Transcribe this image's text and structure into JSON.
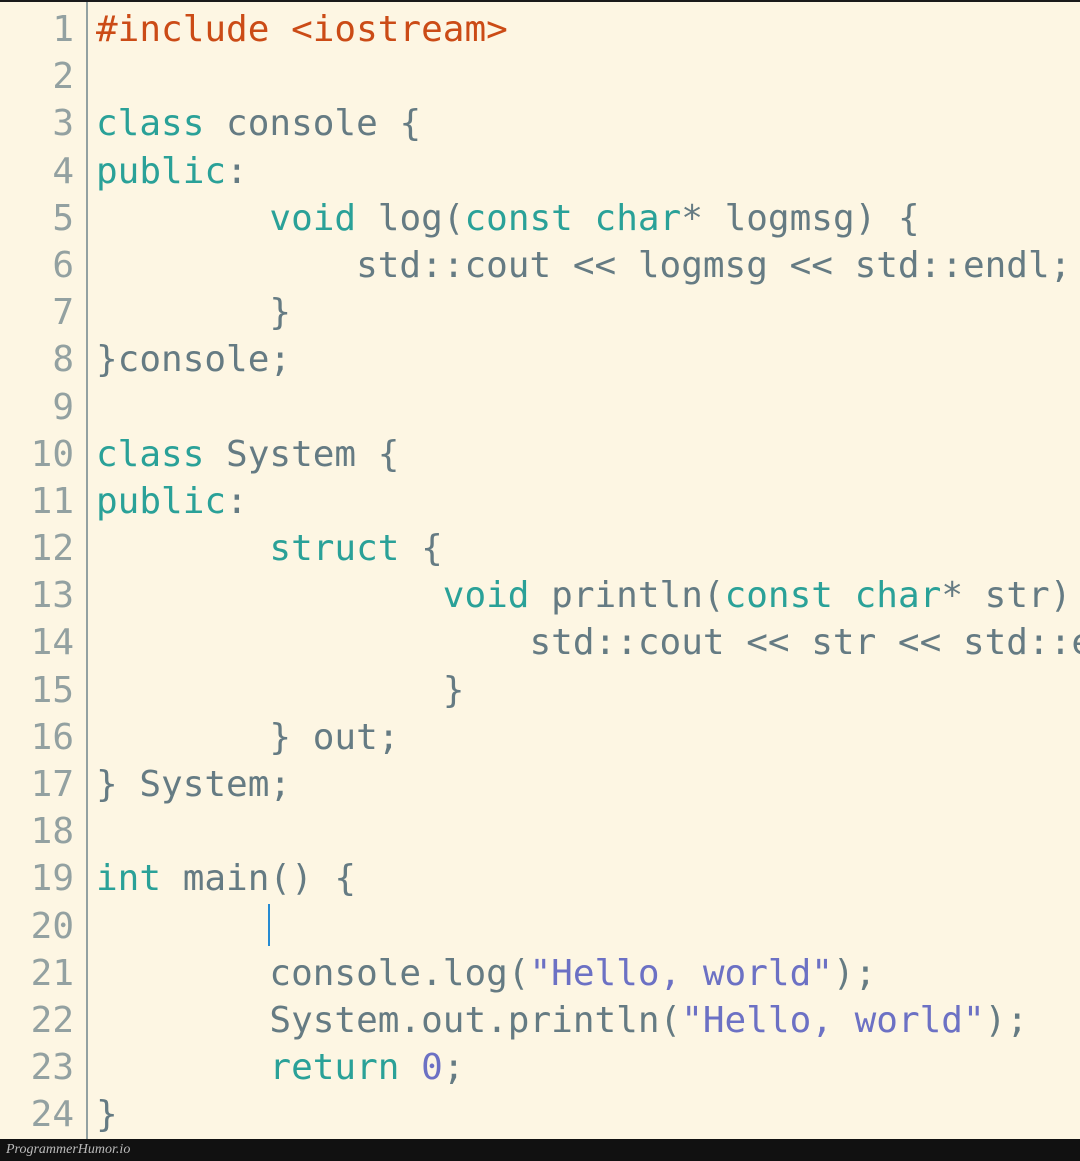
{
  "footer": {
    "text": "ProgrammerHumor.io"
  },
  "cursor": {
    "line": 20,
    "indent": "        "
  },
  "code": {
    "lines": [
      {
        "n": 1,
        "tokens": [
          {
            "cls": "c-preproc",
            "txt": "#include <iostream>"
          }
        ]
      },
      {
        "n": 2,
        "tokens": [
          {
            "cls": "c-default",
            "txt": ""
          }
        ]
      },
      {
        "n": 3,
        "tokens": [
          {
            "cls": "c-keyword",
            "txt": "class"
          },
          {
            "cls": "c-default",
            "txt": " console {"
          }
        ]
      },
      {
        "n": 4,
        "tokens": [
          {
            "cls": "c-keyword",
            "txt": "public"
          },
          {
            "cls": "c-default",
            "txt": ":"
          }
        ]
      },
      {
        "n": 5,
        "tokens": [
          {
            "cls": "c-default",
            "txt": "        "
          },
          {
            "cls": "c-type",
            "txt": "void"
          },
          {
            "cls": "c-default",
            "txt": " log("
          },
          {
            "cls": "c-keyword",
            "txt": "const"
          },
          {
            "cls": "c-default",
            "txt": " "
          },
          {
            "cls": "c-type",
            "txt": "char"
          },
          {
            "cls": "c-default",
            "txt": "* logmsg) {"
          }
        ]
      },
      {
        "n": 6,
        "tokens": [
          {
            "cls": "c-default",
            "txt": "            std::cout << logmsg << std::endl;"
          }
        ]
      },
      {
        "n": 7,
        "tokens": [
          {
            "cls": "c-default",
            "txt": "        }"
          }
        ]
      },
      {
        "n": 8,
        "tokens": [
          {
            "cls": "c-default",
            "txt": "}console;"
          }
        ]
      },
      {
        "n": 9,
        "tokens": [
          {
            "cls": "c-default",
            "txt": ""
          }
        ]
      },
      {
        "n": 10,
        "tokens": [
          {
            "cls": "c-keyword",
            "txt": "class"
          },
          {
            "cls": "c-default",
            "txt": " System {"
          }
        ]
      },
      {
        "n": 11,
        "tokens": [
          {
            "cls": "c-keyword",
            "txt": "public"
          },
          {
            "cls": "c-default",
            "txt": ":"
          }
        ]
      },
      {
        "n": 12,
        "tokens": [
          {
            "cls": "c-default",
            "txt": "        "
          },
          {
            "cls": "c-keyword",
            "txt": "struct"
          },
          {
            "cls": "c-default",
            "txt": " {"
          }
        ]
      },
      {
        "n": 13,
        "tokens": [
          {
            "cls": "c-default",
            "txt": "                "
          },
          {
            "cls": "c-type",
            "txt": "void"
          },
          {
            "cls": "c-default",
            "txt": " println("
          },
          {
            "cls": "c-keyword",
            "txt": "const"
          },
          {
            "cls": "c-default",
            "txt": " "
          },
          {
            "cls": "c-type",
            "txt": "char"
          },
          {
            "cls": "c-default",
            "txt": "* str) {"
          }
        ]
      },
      {
        "n": 14,
        "tokens": [
          {
            "cls": "c-default",
            "txt": "                    std::cout << str << std::endl;"
          }
        ]
      },
      {
        "n": 15,
        "tokens": [
          {
            "cls": "c-default",
            "txt": "                }"
          }
        ]
      },
      {
        "n": 16,
        "tokens": [
          {
            "cls": "c-default",
            "txt": "        } out;"
          }
        ]
      },
      {
        "n": 17,
        "tokens": [
          {
            "cls": "c-default",
            "txt": "} System;"
          }
        ]
      },
      {
        "n": 18,
        "tokens": [
          {
            "cls": "c-default",
            "txt": ""
          }
        ]
      },
      {
        "n": 19,
        "tokens": [
          {
            "cls": "c-type",
            "txt": "int"
          },
          {
            "cls": "c-default",
            "txt": " main() {"
          }
        ]
      },
      {
        "n": 20,
        "tokens": [
          {
            "cls": "c-default",
            "txt": ""
          }
        ]
      },
      {
        "n": 21,
        "tokens": [
          {
            "cls": "c-default",
            "txt": "        console.log("
          },
          {
            "cls": "c-string",
            "txt": "\"Hello, world\""
          },
          {
            "cls": "c-default",
            "txt": ");"
          }
        ]
      },
      {
        "n": 22,
        "tokens": [
          {
            "cls": "c-default",
            "txt": "        System.out.println("
          },
          {
            "cls": "c-string",
            "txt": "\"Hello, world\""
          },
          {
            "cls": "c-default",
            "txt": ");"
          }
        ]
      },
      {
        "n": 23,
        "tokens": [
          {
            "cls": "c-default",
            "txt": "        "
          },
          {
            "cls": "c-keyword",
            "txt": "return"
          },
          {
            "cls": "c-default",
            "txt": " "
          },
          {
            "cls": "c-number",
            "txt": "0"
          },
          {
            "cls": "c-default",
            "txt": ";"
          }
        ]
      },
      {
        "n": 24,
        "tokens": [
          {
            "cls": "c-default",
            "txt": "}"
          }
        ]
      }
    ]
  }
}
